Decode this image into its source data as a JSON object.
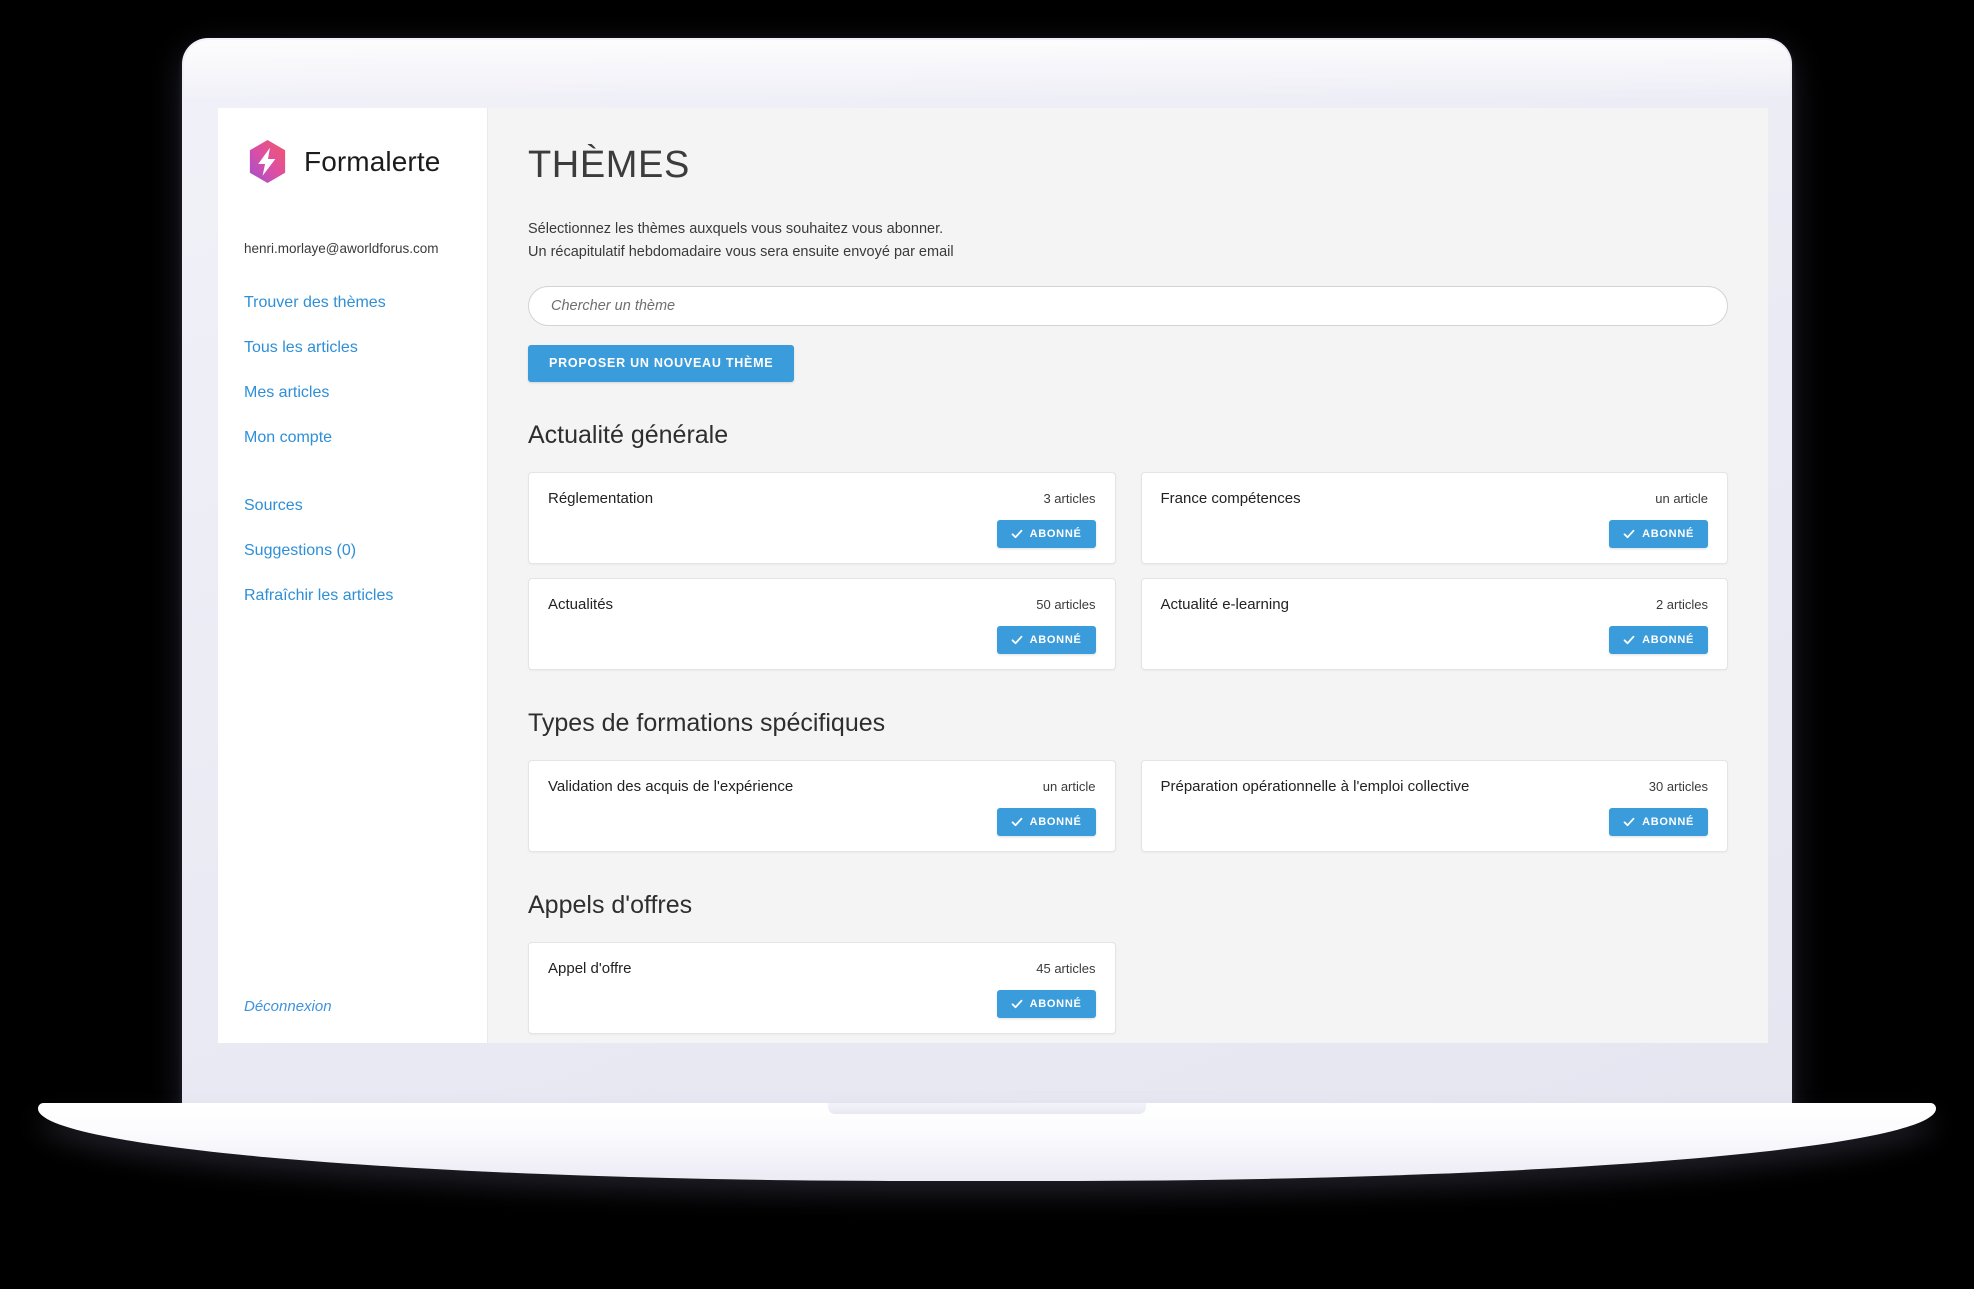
{
  "brand": {
    "name": "Formalerte",
    "logo_icon": "lightning-bolt-hexagon-icon",
    "gradient_from": "#a855c8",
    "gradient_to": "#f2556b"
  },
  "sidebar": {
    "account_email": "henri.morlaye@aworldforus.com",
    "nav_primary": [
      {
        "label": "Trouver des thèmes"
      },
      {
        "label": "Tous les articles"
      },
      {
        "label": "Mes articles"
      },
      {
        "label": "Mon compte"
      }
    ],
    "nav_secondary": [
      {
        "label": "Sources"
      },
      {
        "label": "Suggestions (0)"
      },
      {
        "label": "Rafraîchir les articles"
      }
    ],
    "logout_label": "Déconnexion"
  },
  "main": {
    "page_title": "THÈMES",
    "intro_line_1": "Sélectionnez les thèmes auxquels vous souhaitez vous abonner.",
    "intro_line_2": "Un récapitulatif hebdomadaire vous sera ensuite envoyé par email",
    "search_placeholder": "Chercher un thème",
    "search_value": "",
    "propose_button_label": "PROPOSER UN NOUVEAU THÈME",
    "subscribe_button_label": "ABONNÉ",
    "subscribe_icon": "check-icon",
    "accent_color": "#3b9cdc",
    "sections": [
      {
        "title": "Actualité générale",
        "cards": [
          {
            "title": "Réglementation",
            "count": "3 articles",
            "subscribed_label": "ABONNÉ"
          },
          {
            "title": "France compétences",
            "count": "un article",
            "subscribed_label": "ABONNÉ"
          },
          {
            "title": "Actualités",
            "count": "50 articles",
            "subscribed_label": "ABONNÉ"
          },
          {
            "title": "Actualité e-learning",
            "count": "2 articles",
            "subscribed_label": "ABONNÉ"
          }
        ]
      },
      {
        "title": "Types de formations spécifiques",
        "cards": [
          {
            "title": "Validation des acquis de l'expérience",
            "count": "un article",
            "subscribed_label": "ABONNÉ"
          },
          {
            "title": "Préparation opérationnelle à l'emploi collective",
            "count": "30 articles",
            "subscribed_label": "ABONNÉ"
          }
        ]
      },
      {
        "title": "Appels d'offres",
        "cards": [
          {
            "title": "Appel d'offre",
            "count": "45 articles",
            "subscribed_label": "ABONNÉ"
          }
        ]
      }
    ]
  }
}
